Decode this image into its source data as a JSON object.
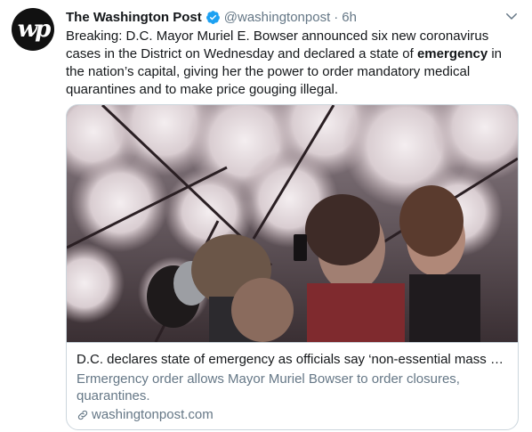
{
  "author": {
    "avatar_text": "wp",
    "name": "The Washington Post",
    "handle": "@washingtonpost",
    "separator": "·",
    "time": "6h"
  },
  "tweet": {
    "text_before": "Breaking: D.C. Mayor Muriel E. Bowser announced six new coronavirus cases in the District on Wednesday and declared a state of ",
    "text_bold": "emergency",
    "text_after": " in the nation’s capital, giving her the power to order mandatory medical quarantines and to make price gouging illegal."
  },
  "card": {
    "title": "D.C. declares state of emergency as officials say ‘non-essential mass gat...",
    "description": "Ermergency order allows Mayor Muriel Bowser to order closures, quarantines.",
    "domain": "washingtonpost.com",
    "image_subject": "cherry-blossom-crowd-photo"
  },
  "icons": {
    "verified": "verified-badge-icon",
    "menu": "chevron-down-icon",
    "link": "link-icon"
  },
  "colors": {
    "verified": "#1da1f2",
    "secondary_text": "#657786",
    "border": "#ccd6dd"
  }
}
